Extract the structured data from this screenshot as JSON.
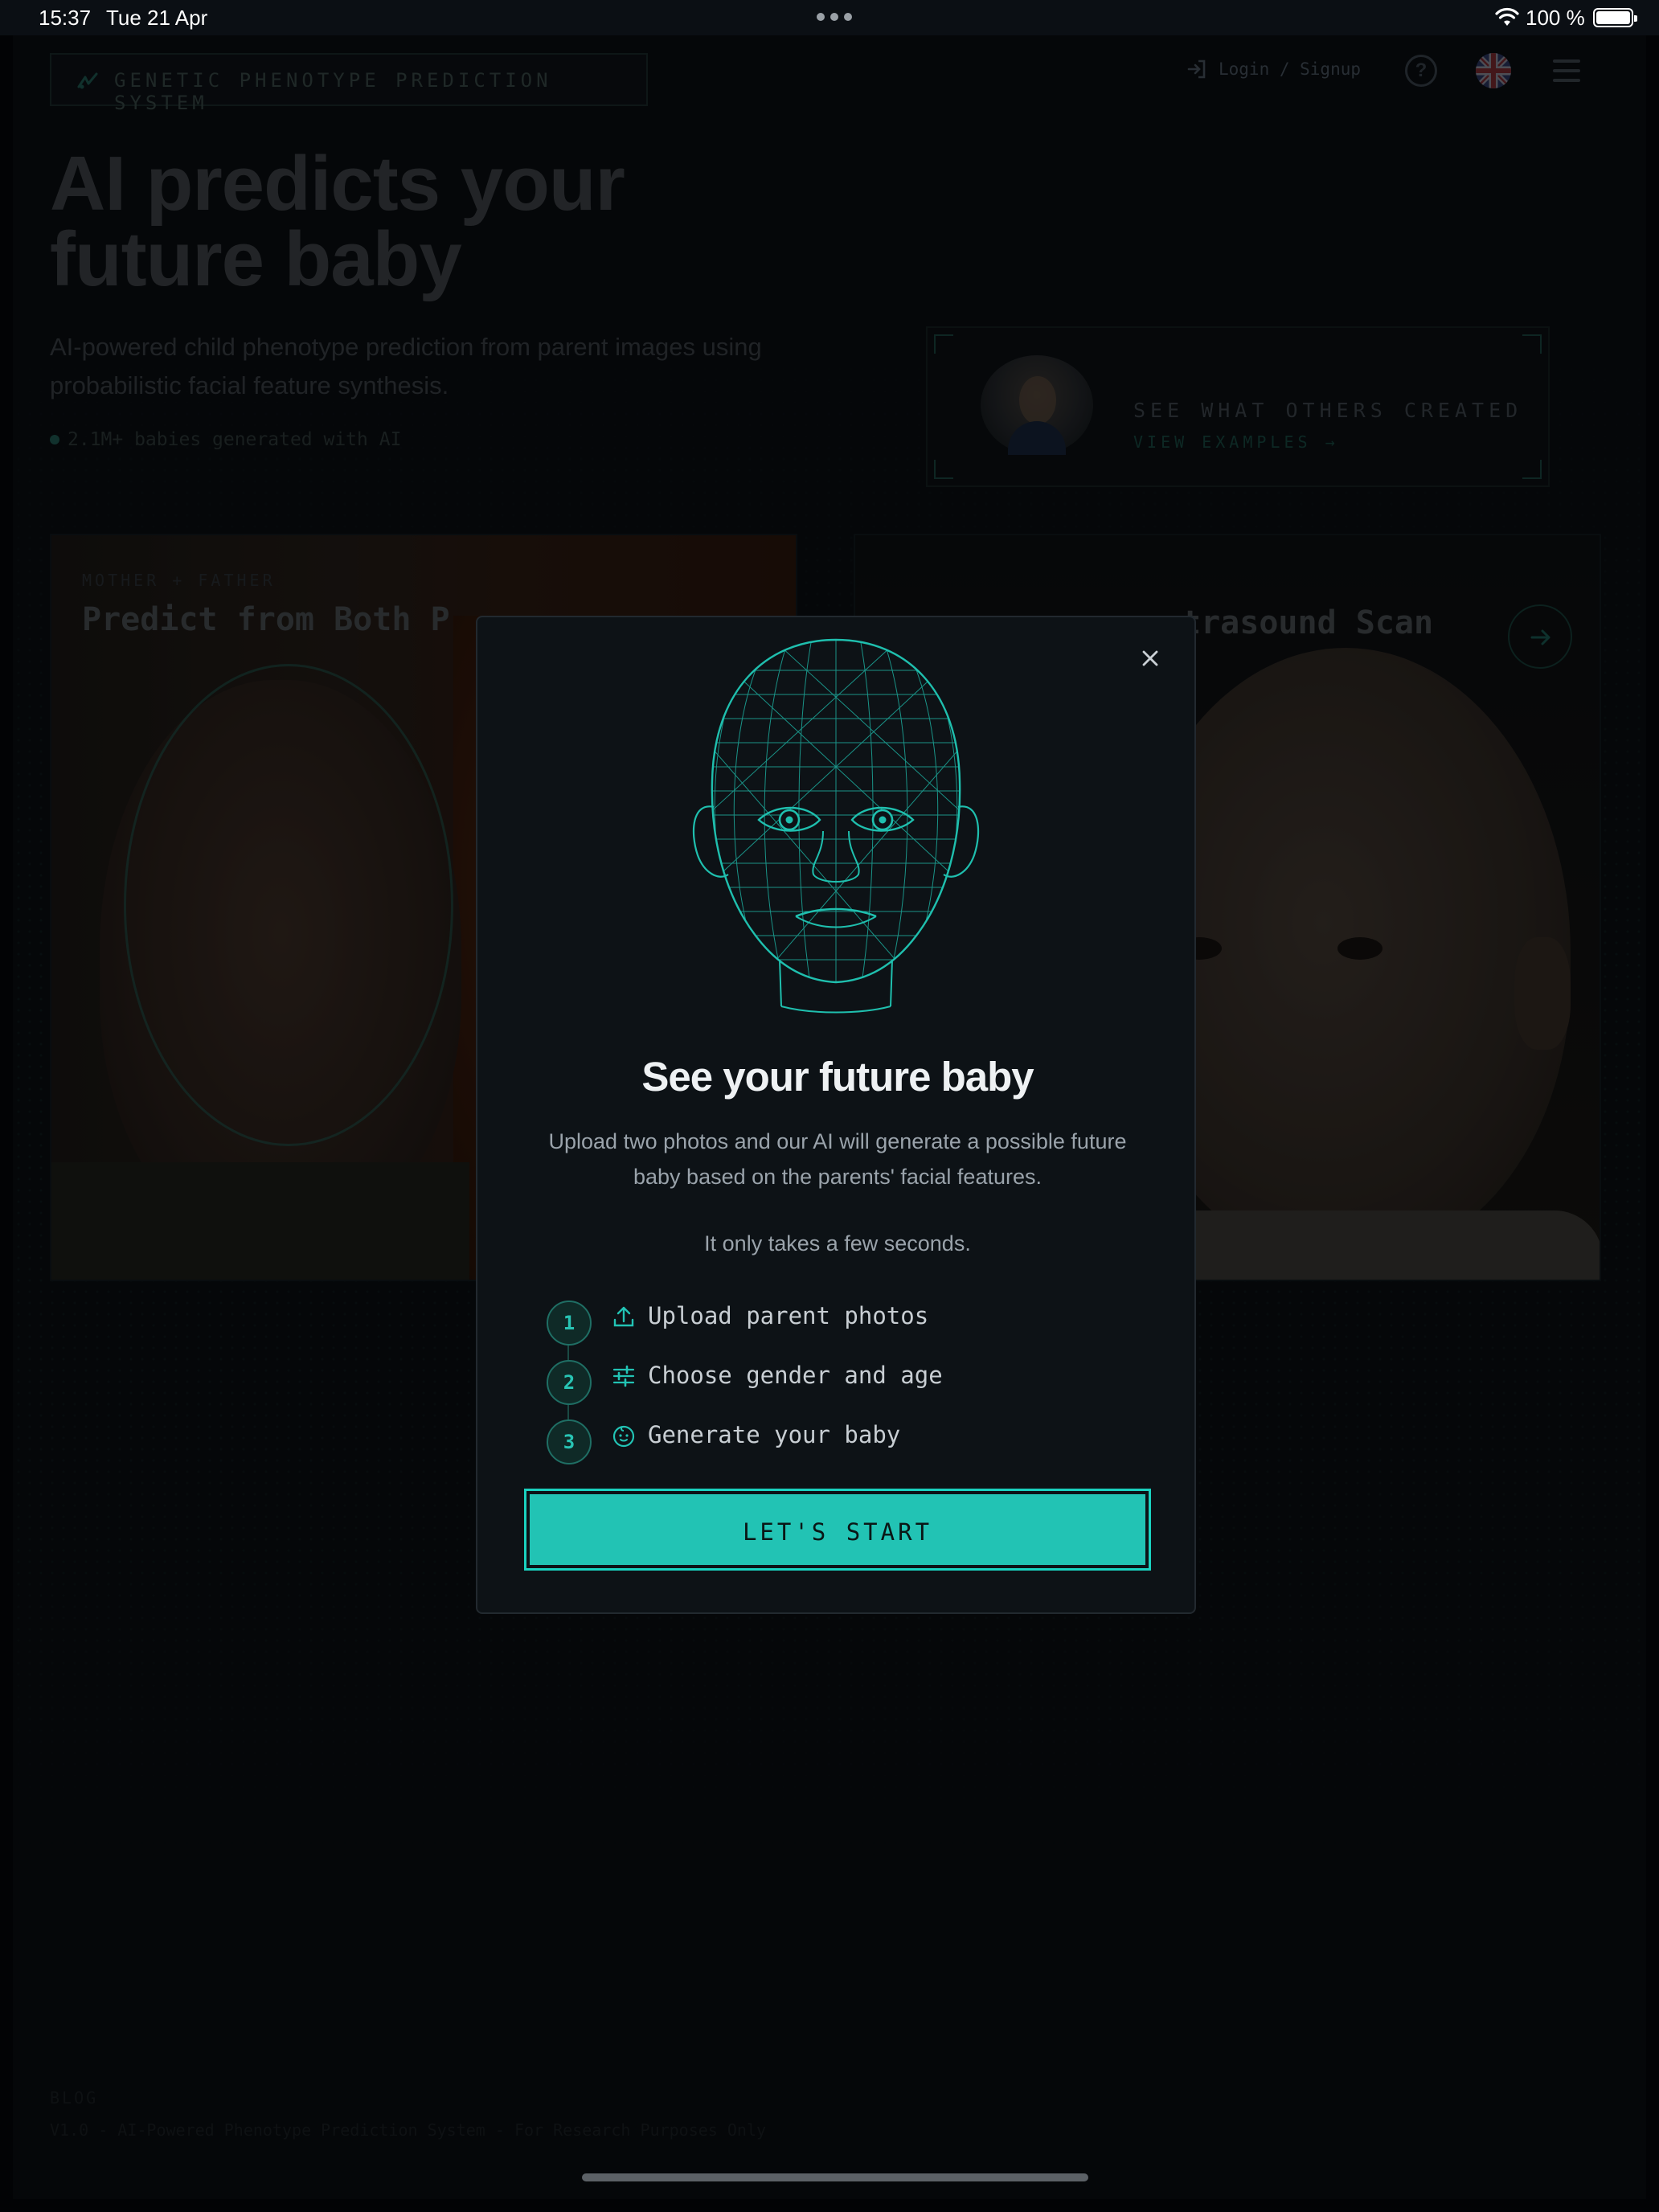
{
  "status_bar": {
    "time": "15:37",
    "date": "Tue 21 Apr",
    "battery": "100 %"
  },
  "header": {
    "brand": "GENETIC PHENOTYPE PREDICTION SYSTEM",
    "login_label": "Login / Signup",
    "help_icon": "question-circle-icon",
    "language_icon": "uk-flag-icon",
    "menu_icon": "hamburger-icon"
  },
  "hero": {
    "title_line1": "AI predicts your",
    "title_line2": "future baby",
    "subtitle_line1": "AI-powered child phenotype prediction from parent images using",
    "subtitle_line2": "probabilistic facial feature synthesis.",
    "stat": "2.1M+ babies generated with AI"
  },
  "examples": {
    "title": "SEE WHAT OTHERS CREATED",
    "link": "VIEW EXAMPLES"
  },
  "cards": {
    "left": {
      "label": "MOTHER + FATHER",
      "title": "Predict from Both P"
    },
    "right": {
      "title": "trasound Scan"
    }
  },
  "modal": {
    "title": "See your future baby",
    "description_line1": "Upload two photos and our AI will generate a possible future",
    "description_line2": "baby based on the parents' facial features.",
    "note": "It only takes a few seconds.",
    "steps": [
      {
        "number": "1",
        "icon": "upload-icon",
        "label": "Upload parent photos"
      },
      {
        "number": "2",
        "icon": "sliders-icon",
        "label": "Choose gender and age"
      },
      {
        "number": "3",
        "icon": "baby-face-icon",
        "label": "Generate your baby"
      }
    ],
    "cta": "LET'S START"
  },
  "colors": {
    "accent": "#22c3b4",
    "background": "#0a0d11",
    "modal_bg": "#0d1216"
  }
}
